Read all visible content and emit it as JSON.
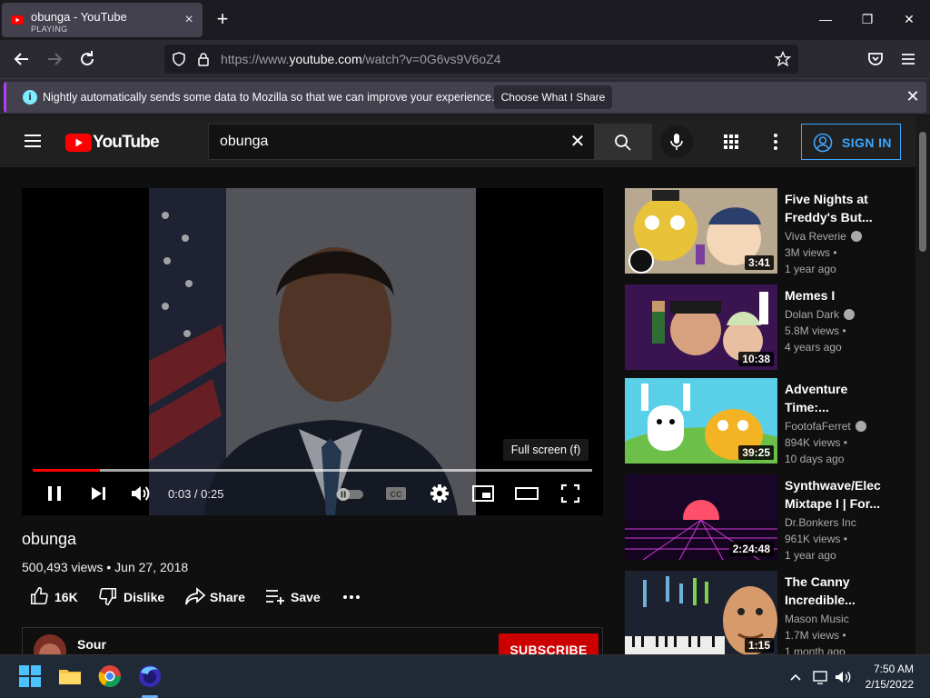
{
  "browser": {
    "tab": {
      "title": "obunga - YouTube",
      "subtitle": "PLAYING",
      "close_icon": "×"
    },
    "new_tab_icon": "+",
    "window": {
      "minimize": "—",
      "restore": "❐",
      "close": "✕"
    },
    "url": {
      "prefix": "https://www.",
      "host": "youtube.com",
      "path": "/watch?v=0G6vs9V6oZ4"
    },
    "infobar": {
      "message": "Nightly automatically sends some data to Mozilla so that we can improve your experience.",
      "button": "Choose What I Share",
      "info_icon": "i",
      "close_icon": "✕"
    }
  },
  "youtube": {
    "logo_text": "YouTube",
    "search": {
      "value": "obunga",
      "clear_icon": "✕"
    },
    "signin_label": "SIGN IN",
    "player": {
      "time": "0:03 / 0:25",
      "progress_fraction": 0.12,
      "tooltip": "Full screen (f)"
    },
    "video": {
      "title": "obunga",
      "meta": "500,493 views • Jun 27, 2018",
      "likes": "16K",
      "dislike_label": "Dislike",
      "share_label": "Share",
      "save_label": "Save"
    },
    "channel": {
      "name": "Sour",
      "subscribe_label": "SUBSCRIBE"
    },
    "recommendations": [
      {
        "title_1": "Five Nights at",
        "title_2": "Freddy's But...",
        "channel": "Viva Reverie",
        "views": "3M views •",
        "age": "1 year ago",
        "duration": "3:41",
        "verified": true
      },
      {
        "title_1": "Memes I",
        "title_2": "",
        "channel": "Dolan Dark",
        "views": "5.8M views •",
        "age": "4 years ago",
        "duration": "10:38",
        "verified": true
      },
      {
        "title_1": "Adventure",
        "title_2": "Time:...",
        "channel": "FootofaFerret",
        "views": "894K views •",
        "age": "10 days ago",
        "duration": "39:25",
        "verified": true
      },
      {
        "title_1": "Synthwave/Elec",
        "title_2": "Mixtape I | For...",
        "channel": "Dr.Bonkers Inc",
        "views": "961K views •",
        "age": "1 year ago",
        "duration": "2:24:48",
        "verified": false
      },
      {
        "title_1": "The Canny",
        "title_2": "Incredible...",
        "channel": "Mason Music",
        "views": "1.7M views •",
        "age": "1 month ago",
        "duration": "1:15",
        "verified": false
      }
    ]
  },
  "taskbar": {
    "time": "7:50 AM",
    "date": "2/15/2022"
  }
}
